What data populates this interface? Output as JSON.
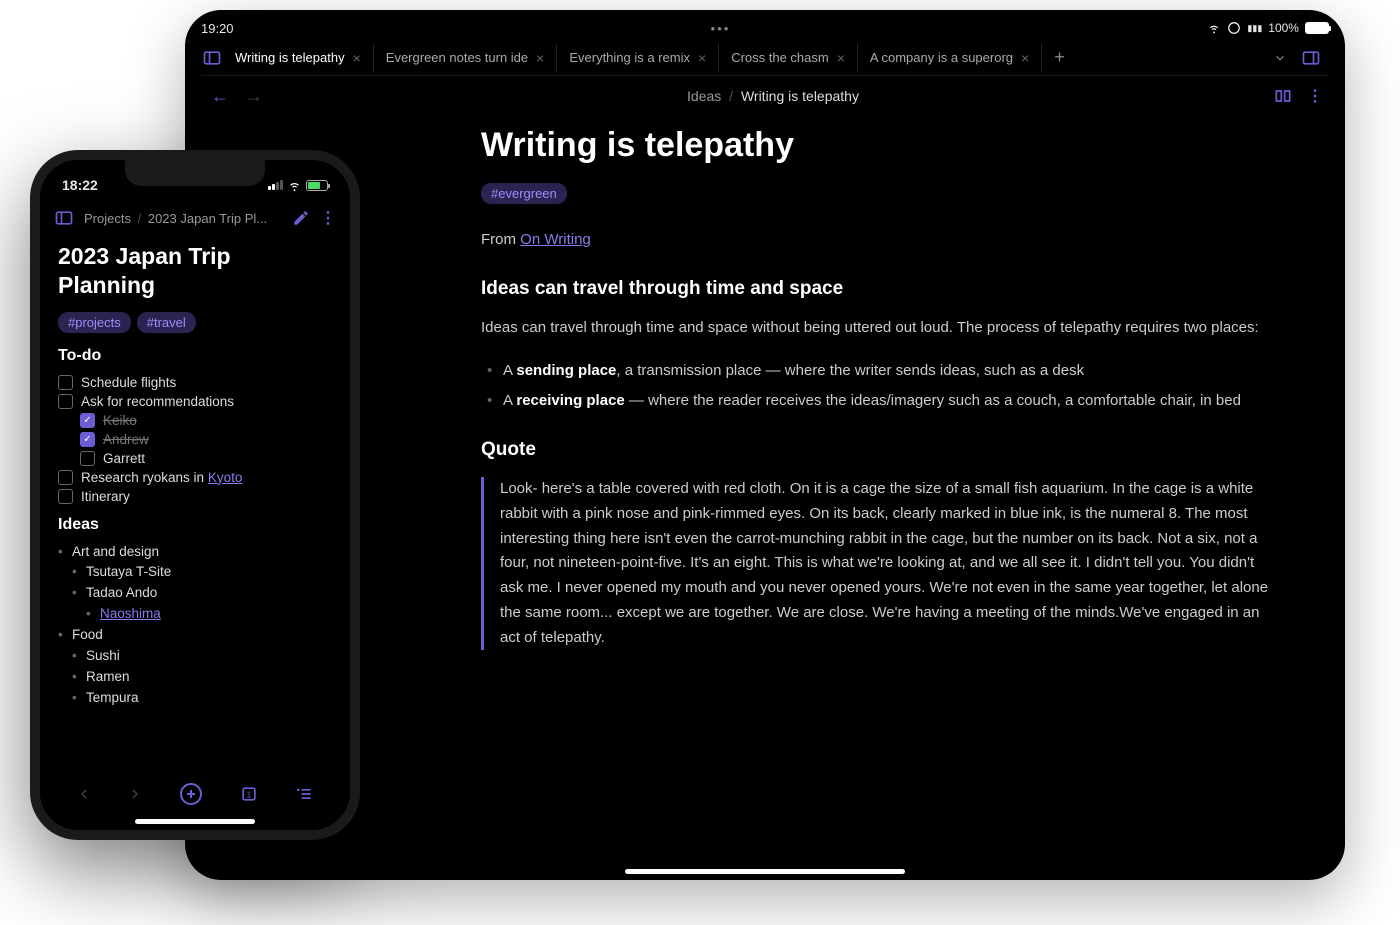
{
  "ipad": {
    "status": {
      "time": "19:20",
      "battery_pct": "100%"
    },
    "tabs": [
      {
        "label": "Writing is telepathy",
        "active": true
      },
      {
        "label": "Evergreen notes turn ide"
      },
      {
        "label": "Everything is a remix"
      },
      {
        "label": "Cross the chasm"
      },
      {
        "label": "A company is a superorg"
      }
    ],
    "breadcrumb": {
      "parent": "Ideas",
      "current": "Writing is telepathy"
    },
    "note": {
      "title": "Writing is telepathy",
      "tag": "#evergreen",
      "from_prefix": "From ",
      "from_link": "On Writing",
      "section1_heading": "Ideas can travel through time and space",
      "section1_para": "Ideas can travel through time and space without being uttered out loud. The process of telepathy requires two places:",
      "bullets": [
        {
          "pre": "A ",
          "strong": "sending place",
          "rest": ", a transmission place — where the writer sends ideas, such as a desk"
        },
        {
          "pre": "A ",
          "strong": "receiving place",
          "rest": " — where the reader receives the ideas/imagery such as a couch, a comfortable chair, in bed"
        }
      ],
      "quote_heading": "Quote",
      "quote": "Look- here's a table covered with red cloth. On it is a cage the size of a small fish aquarium. In the cage is a white rabbit with a pink nose and pink-rimmed eyes. On its back, clearly marked in blue ink, is the numeral 8. The most interesting thing here isn't even the carrot-munching rabbit in the cage, but the number on its back. Not a six, not a four, not nineteen-point-five. It's an eight. This is what we're looking at, and we all see it. I didn't tell you. You didn't ask me. I never opened my mouth and you never opened yours. We're not even in the same year together, let alone the same room... except we are together. We are close. We're having a meeting of the minds.We've engaged in an act of telepathy."
    }
  },
  "iphone": {
    "status": {
      "time": "18:22"
    },
    "breadcrumb": {
      "parent": "Projects",
      "current": "2023 Japan Trip Pl..."
    },
    "note": {
      "title": "2023 Japan Trip Planning",
      "tags": [
        "#projects",
        "#travel"
      ],
      "todo_heading": "To-do",
      "todos": [
        {
          "label": "Schedule flights",
          "checked": false,
          "indent": 0
        },
        {
          "label": "Ask for recommendations",
          "checked": false,
          "indent": 0
        },
        {
          "label": "Keiko",
          "checked": true,
          "indent": 1
        },
        {
          "label": "Andrew",
          "checked": true,
          "indent": 1
        },
        {
          "label": "Garrett",
          "checked": false,
          "indent": 1
        },
        {
          "label_pre": "Research ryokans in ",
          "link": "Kyoto",
          "checked": false,
          "indent": 0
        },
        {
          "label": "Itinerary",
          "checked": false,
          "indent": 0
        }
      ],
      "ideas_heading": "Ideas",
      "ideas": [
        {
          "label": "Art and design",
          "indent": 0
        },
        {
          "label": "Tsutaya T-Site",
          "indent": 1
        },
        {
          "label": "Tadao Ando",
          "indent": 1
        },
        {
          "link": "Naoshima",
          "indent": 2
        },
        {
          "label": "Food",
          "indent": 0
        },
        {
          "label": "Sushi",
          "indent": 1
        },
        {
          "label": "Ramen",
          "indent": 1
        },
        {
          "label": "Tempura",
          "indent": 1
        }
      ]
    }
  }
}
